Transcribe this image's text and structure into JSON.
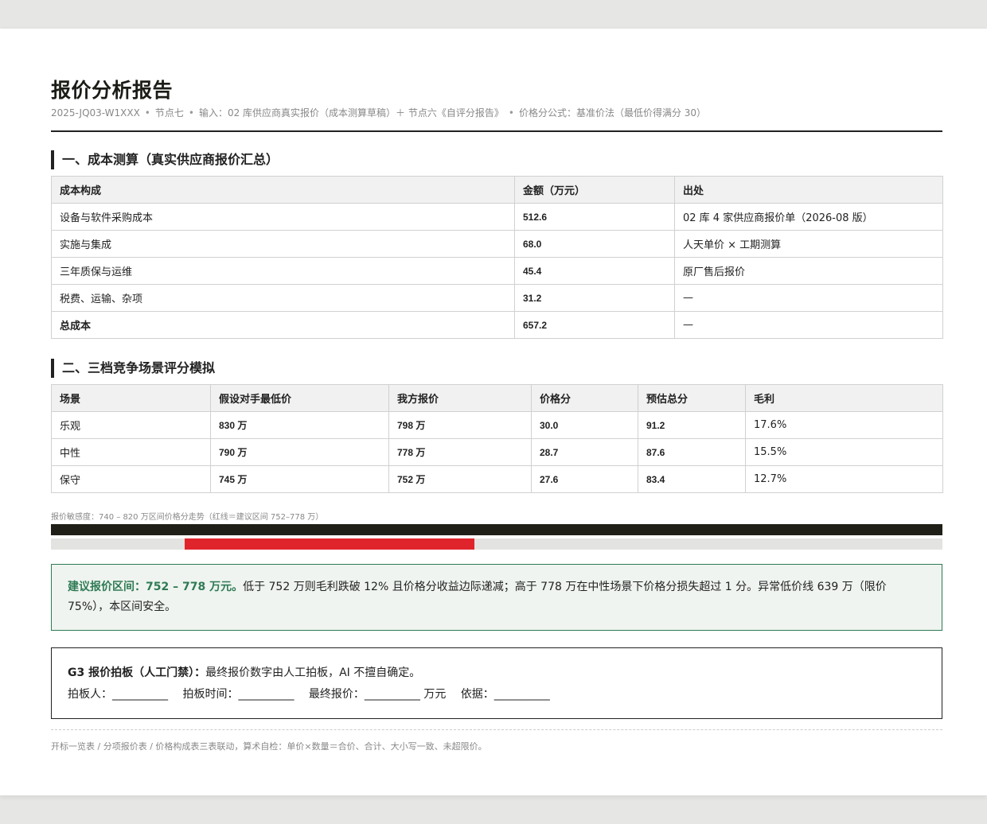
{
  "report": {
    "title": "报价分析报告",
    "meta": {
      "code": "2025-JQ03-W1XXX",
      "node": "节点七",
      "input": "输入：02 库供应商真实报价（成本测算草稿）＋ 节点六《自评分报告》",
      "formula": "价格分公式：基准价法（最低价得满分 30）"
    }
  },
  "cost": {
    "heading": "一、成本测算（真实供应商报价汇总）",
    "headers": [
      "成本构成",
      "金额（万元）",
      "出处"
    ],
    "rows": [
      {
        "item": "设备与软件采购成本",
        "amount": "512.6",
        "source": "02 库 4 家供应商报价单（2026-08 版）"
      },
      {
        "item": "实施与集成",
        "amount": "68.0",
        "source": "人天单价 × 工期测算"
      },
      {
        "item": "三年质保与运维",
        "amount": "45.4",
        "source": "原厂售后报价"
      },
      {
        "item": "税费、运输、杂项",
        "amount": "31.2",
        "source": "—"
      },
      {
        "item": "总成本",
        "amount": "657.2",
        "source": "—"
      }
    ]
  },
  "scenarios": {
    "heading": "二、三档竞争场景评分模拟",
    "headers": [
      "场景",
      "假设对手最低价",
      "我方报价",
      "价格分",
      "预估总分",
      "毛利"
    ],
    "rows": [
      {
        "name": "乐观",
        "rival": "830 万",
        "ours": "798 万",
        "price_score": "30.0",
        "total": "91.2",
        "margin": "17.6%"
      },
      {
        "name": "中性",
        "rival": "790 万",
        "ours": "778 万",
        "price_score": "28.7",
        "total": "87.6",
        "margin": "15.5%"
      },
      {
        "name": "保守",
        "rival": "745 万",
        "ours": "752 万",
        "price_score": "27.6",
        "total": "83.4",
        "margin": "12.7%"
      }
    ]
  },
  "sensitivity": {
    "label": "报价敏感度：740 – 820 万区间价格分走势（红线＝建议区间 752–778 万）",
    "range_min": 740,
    "range_max": 820,
    "suggest_low": 752,
    "suggest_high": 778,
    "colors": {
      "dark": "#1f1f17",
      "red": "#e0242c",
      "track": "#e3e3e1"
    }
  },
  "advice": {
    "highlight": "建议报价区间：752 – 778 万元。",
    "text": "低于 752 万则毛利跌破 12% 且价格分收益边际递减；高于 778 万在中性场景下价格分损失超过 1 分。异常低价线 639 万（限价 75%），本区间安全。"
  },
  "gate": {
    "title": "G3 报价拍板（人工门禁）：",
    "desc": "最终报价数字由人工拍板，AI 不擅自确定。",
    "fields": {
      "decider": "拍板人：__________",
      "time": "拍板时间：__________",
      "price": "最终报价：__________ 万元",
      "basis": "依据：__________"
    }
  },
  "footer": "开标一览表 / 分项报价表 / 价格构成表三表联动，算术自检：单价×数量＝合价、合计、大小写一致、未超限价。",
  "colors": {
    "accent_green": "#2f7a54",
    "advice_bg": "#eff4f0",
    "ink": "#222222"
  }
}
